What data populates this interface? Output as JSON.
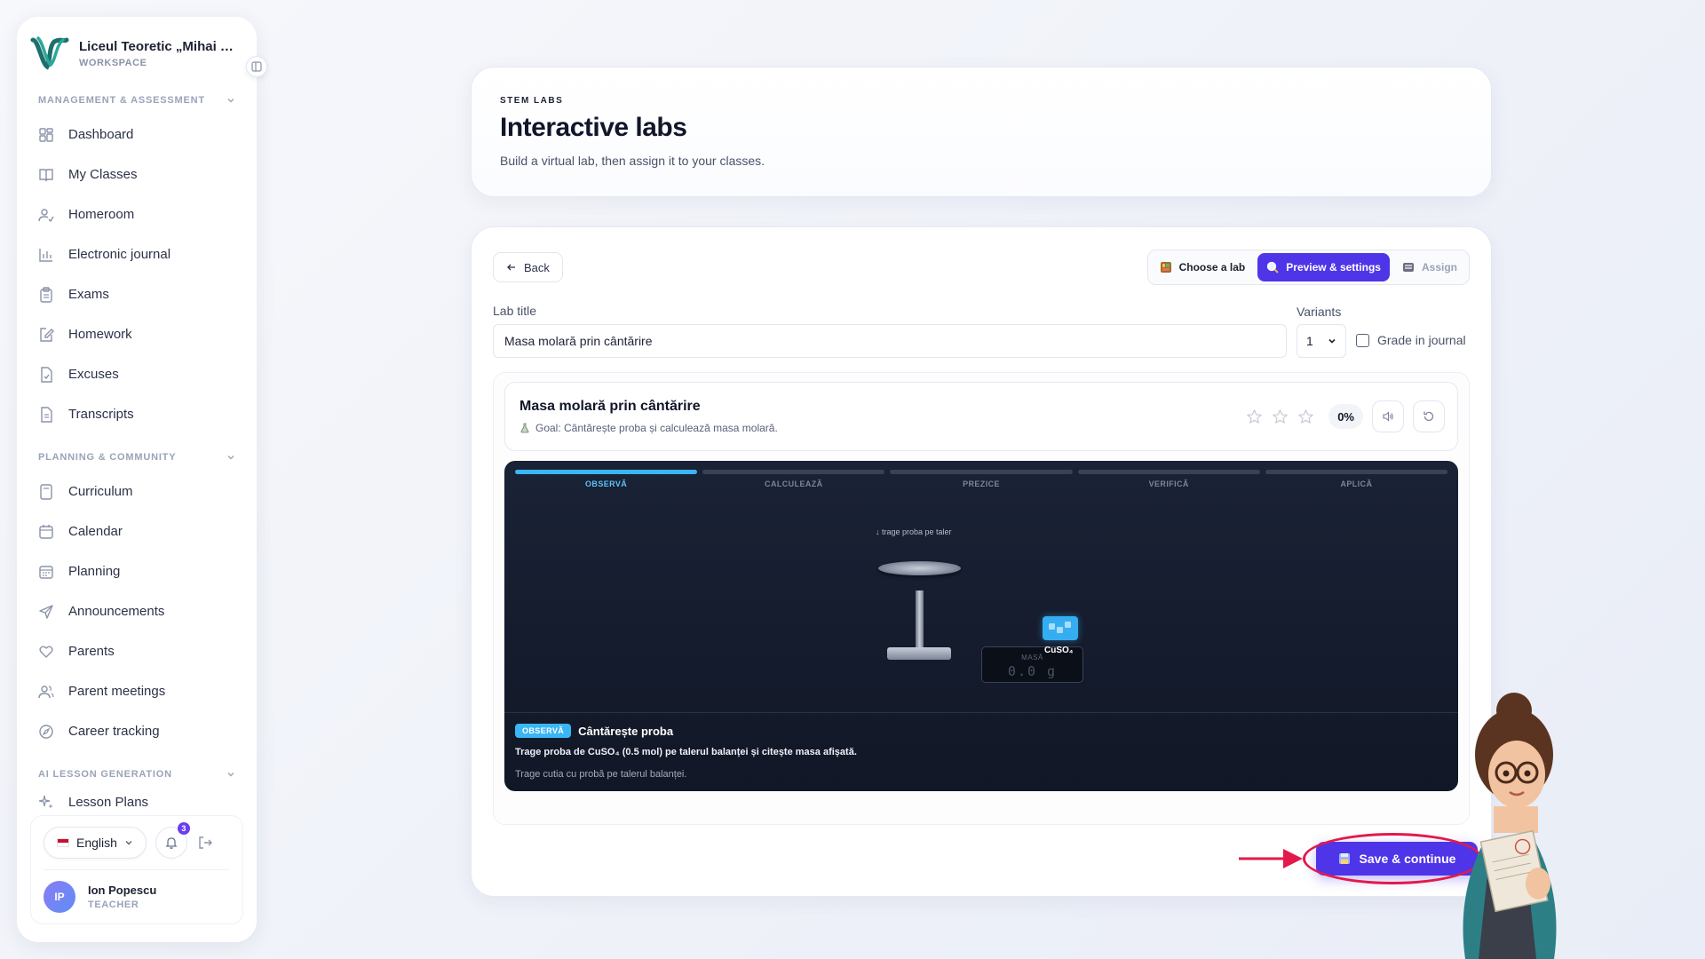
{
  "workspace": {
    "name": "Liceul Teoretic „Mihai Eminescu”",
    "subtitle": "WORKSPACE"
  },
  "sidebar": {
    "sections": [
      {
        "title": "MANAGEMENT & ASSESSMENT",
        "items": [
          {
            "label": "Dashboard",
            "icon": "dashboard-icon"
          },
          {
            "label": "My Classes",
            "icon": "book-icon"
          },
          {
            "label": "Homeroom",
            "icon": "user-check-icon"
          },
          {
            "label": "Electronic journal",
            "icon": "bar-chart-icon"
          },
          {
            "label": "Exams",
            "icon": "clipboard-icon"
          },
          {
            "label": "Homework",
            "icon": "edit-icon"
          },
          {
            "label": "Excuses",
            "icon": "file-check-icon"
          },
          {
            "label": "Transcripts",
            "icon": "file-text-icon"
          }
        ]
      },
      {
        "title": "PLANNING & COMMUNITY",
        "items": [
          {
            "label": "Curriculum",
            "icon": "notebook-icon"
          },
          {
            "label": "Calendar",
            "icon": "calendar-icon"
          },
          {
            "label": "Planning",
            "icon": "calendar-grid-icon"
          },
          {
            "label": "Announcements",
            "icon": "send-icon"
          },
          {
            "label": "Parents",
            "icon": "heart-icon"
          },
          {
            "label": "Parent meetings",
            "icon": "users-icon"
          },
          {
            "label": "Career tracking",
            "icon": "compass-icon"
          }
        ]
      },
      {
        "title": "AI LESSON GENERATION",
        "items": [
          {
            "label": "Lesson Plans",
            "icon": "sparkle-icon"
          }
        ]
      }
    ],
    "footer": {
      "language": "English",
      "notifications": "3",
      "user_name": "Ion Popescu",
      "user_role": "TEACHER",
      "user_initials": "IP"
    }
  },
  "header": {
    "eyebrow": "STEM LABS",
    "title": "Interactive labs",
    "subtitle": "Build a virtual lab, then assign it to your classes."
  },
  "toolbar": {
    "back_label": "Back",
    "steps": [
      {
        "label": "Choose a lab",
        "state": "done"
      },
      {
        "label": "Preview & settings",
        "state": "active"
      },
      {
        "label": "Assign",
        "state": "disabled"
      }
    ]
  },
  "form": {
    "lab_title_label": "Lab title",
    "lab_title_value": "Masa molară prin cântărire",
    "variants_label": "Variants",
    "variants_value": "1",
    "grade_label": "Grade in journal",
    "grade_checked": false
  },
  "lab": {
    "title": "Masa molară prin cântărire",
    "goal": "Goal: Cântărește proba și calculează masa molară.",
    "stars": 0,
    "stars_max": 3,
    "progress": "0%",
    "phases": [
      {
        "label": "OBSERVĂ",
        "active": true
      },
      {
        "label": "CALCULEAZĂ",
        "active": false
      },
      {
        "label": "PREZICE",
        "active": false
      },
      {
        "label": "VERIFICĂ",
        "active": false
      },
      {
        "label": "APLICĂ",
        "active": false
      }
    ],
    "sim": {
      "hint": "↓ trage proba pe taler",
      "display_label": "MASĂ",
      "display_value": "0.0 g",
      "sample_label": "CuSO₄"
    },
    "footer": {
      "chip": "OBSERVĂ",
      "title": "Cântărește proba",
      "description": "Trage proba de CuSO₄ (0.5 mol) pe talerul balanței și citește masa afișată.",
      "hint": "Trage cutia cu probă pe talerul balanței."
    }
  },
  "actions": {
    "save_label": "Save & continue"
  },
  "colors": {
    "accent": "#4f35e8",
    "phase_active": "#3ab6f5",
    "highlight": "#e3194b"
  }
}
